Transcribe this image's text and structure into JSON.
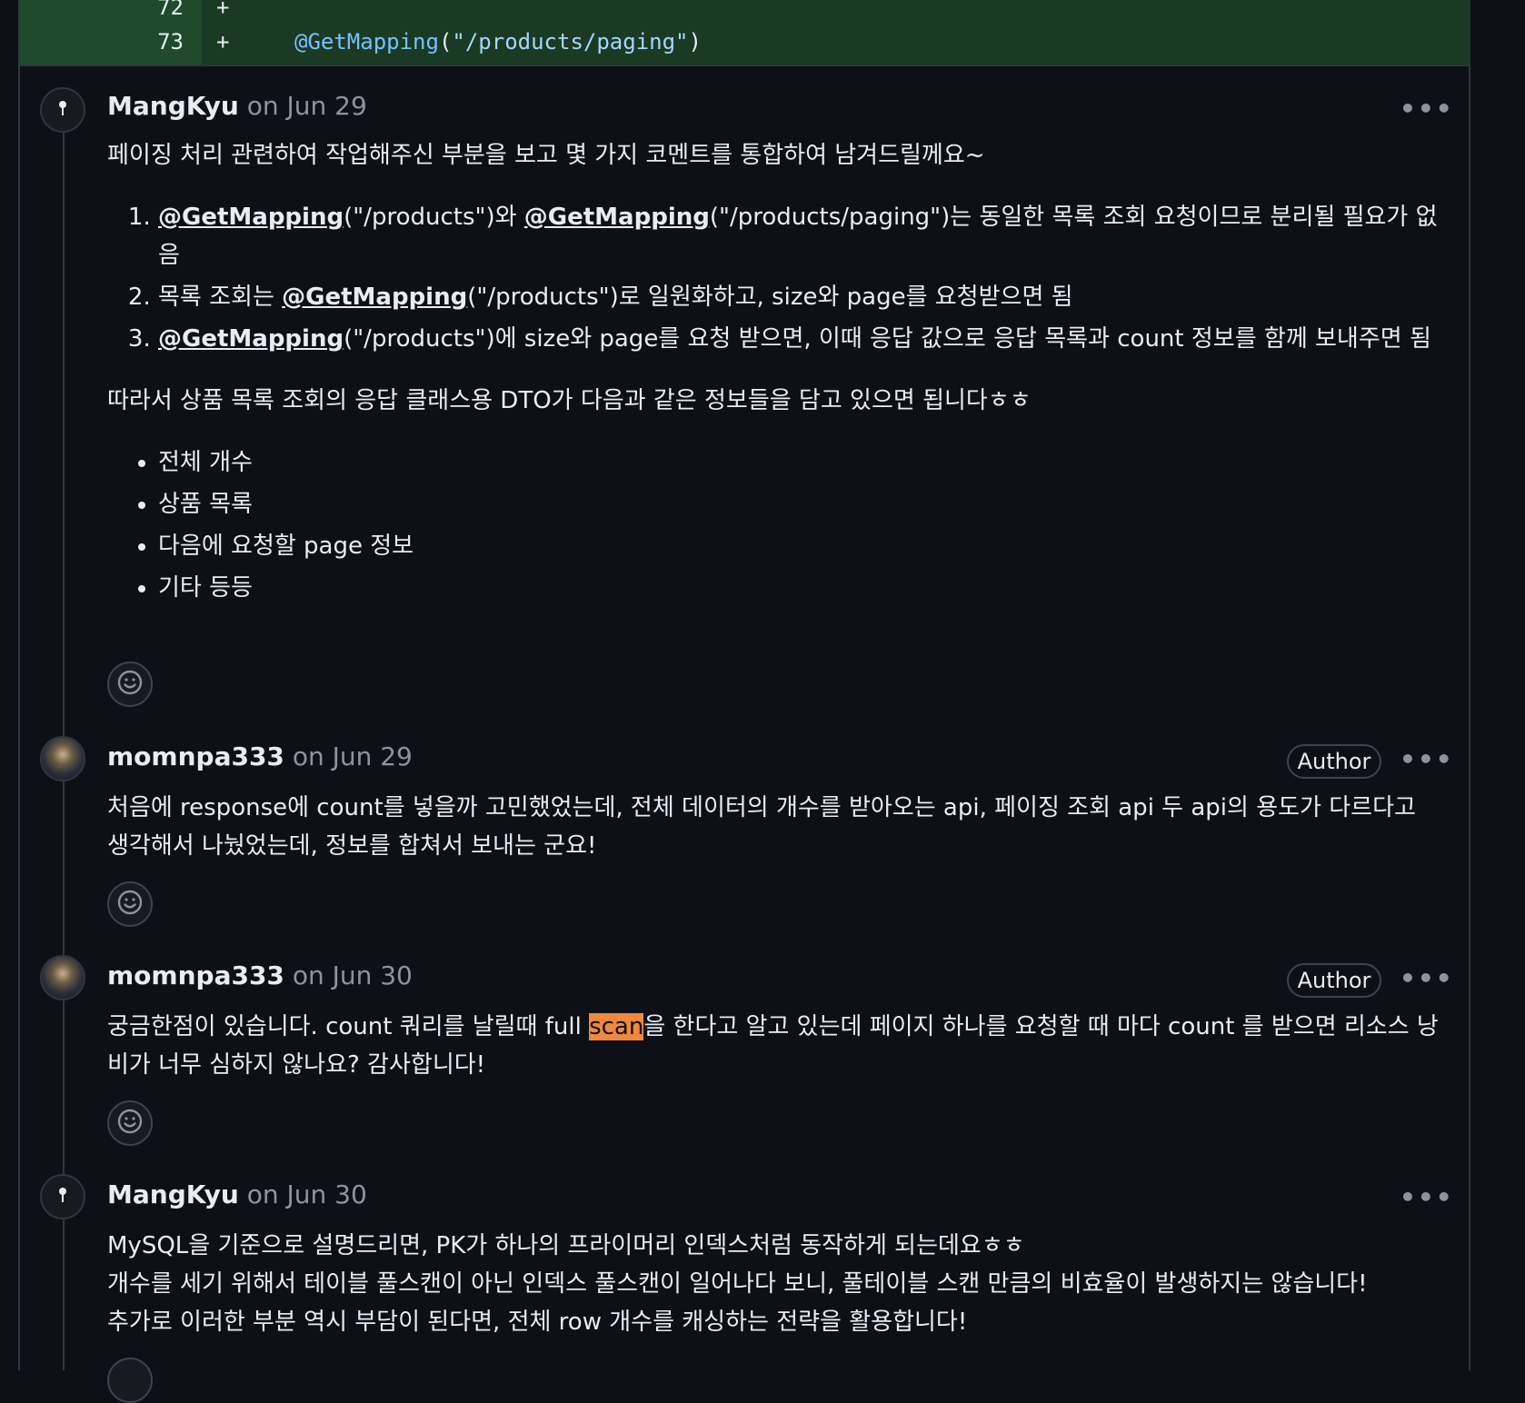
{
  "diff": {
    "lines": [
      {
        "num": "72",
        "sign": "+",
        "code_annotation": "",
        "code_string": "",
        "code_close": ""
      },
      {
        "num": "73",
        "sign": "+",
        "code_annotation": "@GetMapping",
        "code_open": "(",
        "code_string": "\"/products/paging\"",
        "code_close": ")"
      }
    ]
  },
  "comments": [
    {
      "user": "MangKyu",
      "date": "on Jun 29",
      "more": "•••",
      "intro": "페이징 처리 관련하여 작업해주신 부분을 보고 몇 가지 코멘트를 통합하여 남겨드릴께요~",
      "ol": [
        {
          "m1": "@GetMapping",
          "t1": "(\"/products\")와 ",
          "m2": "@GetMapping",
          "t2": "(\"/products/paging\")는 동일한 목록 조회 요청이므로 분리될 필요가 없음"
        },
        {
          "t0": "목록 조회는 ",
          "m1": "@GetMapping",
          "t1": "(\"/products\")로 일원화하고, size와 page를 요청받으면 됨"
        },
        {
          "m1": "@GetMapping",
          "t1": "(\"/products\")에 size와 page를 요청 받으면, 이때 응답 값으로 응답 목록과 count 정보를 함께 보내주면 됨"
        }
      ],
      "after": "따라서 상품 목록 조회의 응답 클래스용 DTO가 다음과 같은 정보들을 담고 있으면 됩니다ㅎㅎ",
      "ul": [
        "전체 개수",
        "상품 목록",
        "다음에 요청할 page 정보",
        "기타 등등"
      ]
    },
    {
      "user": "momnpa333",
      "date": "on Jun 29",
      "badge": "Author",
      "more": "•••",
      "text": "처음에 response에 count를 넣을까 고민했었는데, 전체 데이터의 개수를 받아오는 api, 페이징 조회 api 두 api의 용도가 다르다고 생각해서 나눴었는데, 정보를 합쳐서 보내는 군요!"
    },
    {
      "user": "momnpa333",
      "date": "on Jun 30",
      "badge": "Author",
      "more": "•••",
      "text_before": "궁금한점이 있습니다. count 쿼리를 날릴때 full ",
      "text_highlight": "scan",
      "text_after": "을 한다고 알고 있는데 페이지 하나를 요청할 때 마다 count 를 받으면 리소스 낭비가 너무 심하지 않나요? 감사합니다!"
    },
    {
      "user": "MangKyu",
      "date": "on Jun 30",
      "more": "•••",
      "lines": [
        "MySQL을 기준으로 설명드리면, PK가 하나의 프라이머리 인덱스처럼 동작하게 되는데요ㅎㅎ",
        "개수를 세기 위해서 테이블 풀스캔이 아닌 인덱스 풀스캔이 일어나다 보니, 풀테이블 스캔 만큼의 비효율이 발생하지는 않습니다!",
        "추가로 이러한 부분 역시 부담이 된다면, 전체 row 개수를 캐싱하는 전략을 활용합니다!"
      ]
    }
  ],
  "icons": {
    "avatar_pin": "pin-icon",
    "reaction": "smiley-icon"
  }
}
